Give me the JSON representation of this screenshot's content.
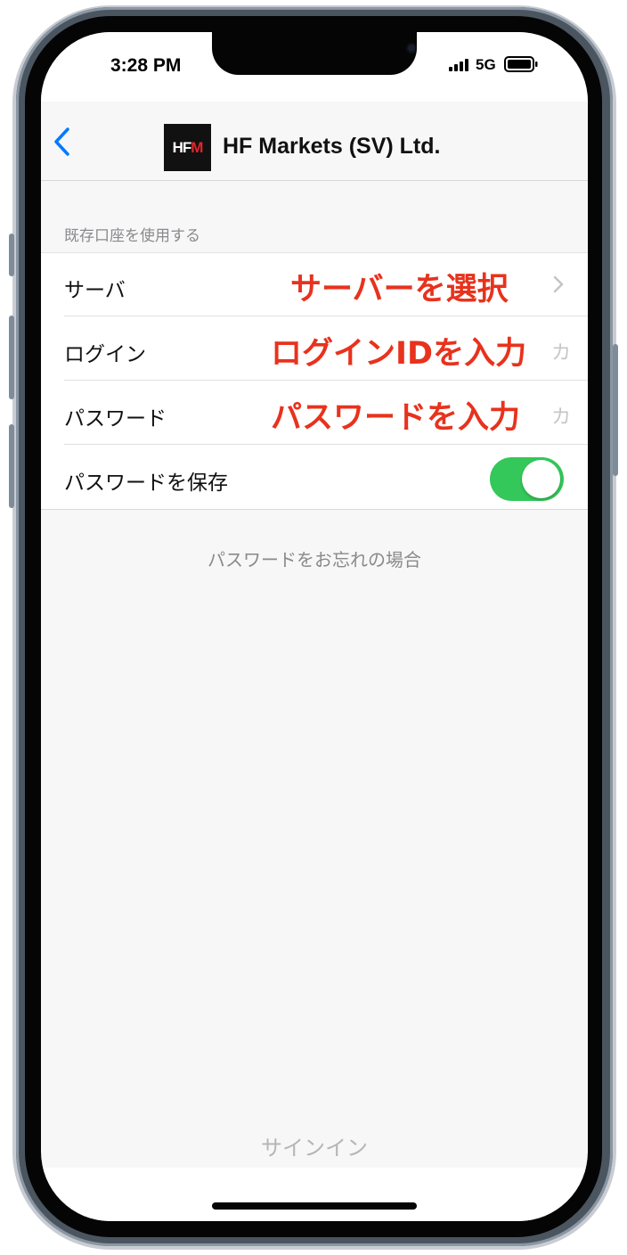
{
  "status_bar": {
    "time": "3:28 PM",
    "network": "5G"
  },
  "nav": {
    "logo_text_white": "HF",
    "logo_text_red": "M",
    "title": "HF Markets (SV) Ltd."
  },
  "section_header": "既存口座を使用する",
  "rows": [
    {
      "label": "サーバ",
      "annotation": "サーバーを選択"
    },
    {
      "label": "ログイン",
      "annotation": "ログインIDを入力",
      "ghost": "カ"
    },
    {
      "label": "パスワード",
      "annotation": "パスワードを入力",
      "ghost": "カ"
    },
    {
      "label": "パスワードを保存",
      "toggle_on": true
    }
  ],
  "forgot_password": "パスワードをお忘れの場合",
  "sign_in": "サインイン",
  "colors": {
    "accent": "#007aff",
    "toggle": "#34c759",
    "annotation": "#e8321d"
  },
  "icons": [
    "back-chevron-icon",
    "chevron-right-icon",
    "signal-icon",
    "battery-icon"
  ]
}
